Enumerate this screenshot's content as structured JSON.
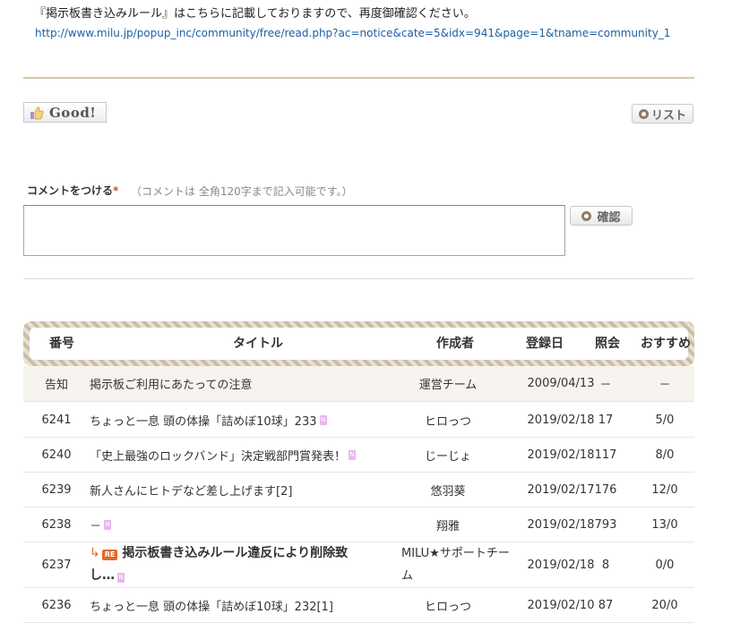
{
  "notice_text": "『掲示板書き込みルール』はこちらに記載しておりますので、再度御確認ください。",
  "notice_link": "http://www.milu.jp/popup_inc/community/free/read.php?ac=notice&cate=5&idx=941&page=1&tname=community_1",
  "good_button": {
    "label": "Good!",
    "icon": "thumbs-up-icon"
  },
  "list_button": {
    "label": "リスト",
    "icon": "circle-dot-icon"
  },
  "comment": {
    "label": "コメントをつける",
    "required_mark": "*",
    "hint": "（コメントは 全角120字まで記入可能です。）",
    "value": "",
    "confirm_label": "確認"
  },
  "table": {
    "headers": [
      "番号",
      "タイトル",
      "作成者",
      "登録日",
      "照会",
      "おすすめ"
    ],
    "notice_row": {
      "no": "告知",
      "title": "掲示板ご利用にあたっての注意",
      "author": "運営チーム",
      "date": "2009/04/13",
      "views": "－",
      "rec": "－"
    },
    "rows": [
      {
        "no": "6241",
        "title": "ちょっと一息 頭の体操「詰めぼ10球」233",
        "new": true,
        "author": "ヒロっつ",
        "date": "2019/02/18",
        "views": "17",
        "rec": "5/0"
      },
      {
        "no": "6240",
        "title": "「史上最強のロックバンド」決定戦部門賞発表！",
        "new": true,
        "author": "じーじょ",
        "date": "2019/02/18",
        "views": "117",
        "rec": "8/0"
      },
      {
        "no": "6239",
        "title": "新人さんにヒトデなど差し上げます[2]",
        "new": false,
        "author": "悠羽葵",
        "date": "2019/02/17",
        "views": "176",
        "rec": "12/0"
      },
      {
        "no": "6238",
        "title": "－",
        "new": true,
        "author": "翔雅",
        "date": "2019/02/18",
        "views": "793",
        "rec": "13/0"
      },
      {
        "no": "6237",
        "title_line1": "掲示板書き込みルール違反により削除致",
        "title_line2": "し…",
        "re_badge": "RE",
        "new": true,
        "author_line1": "MILU★サポートチー",
        "author_line2": "ム",
        "date": "2019/02/18",
        "views": "8",
        "rec": "0/0"
      },
      {
        "no": "6236",
        "title": "ちょっと一息 頭の体操「詰めぼ10球」232[1]",
        "new": false,
        "author": "ヒロっつ",
        "date": "2019/02/10",
        "views": "87",
        "rec": "20/0"
      }
    ]
  },
  "colors": {
    "accent_tan": "#d9c8a3",
    "link": "#1f5fa0",
    "reply": "#e06a2a",
    "new_badge": "#e8b8ee",
    "required": "#d64b2a"
  }
}
